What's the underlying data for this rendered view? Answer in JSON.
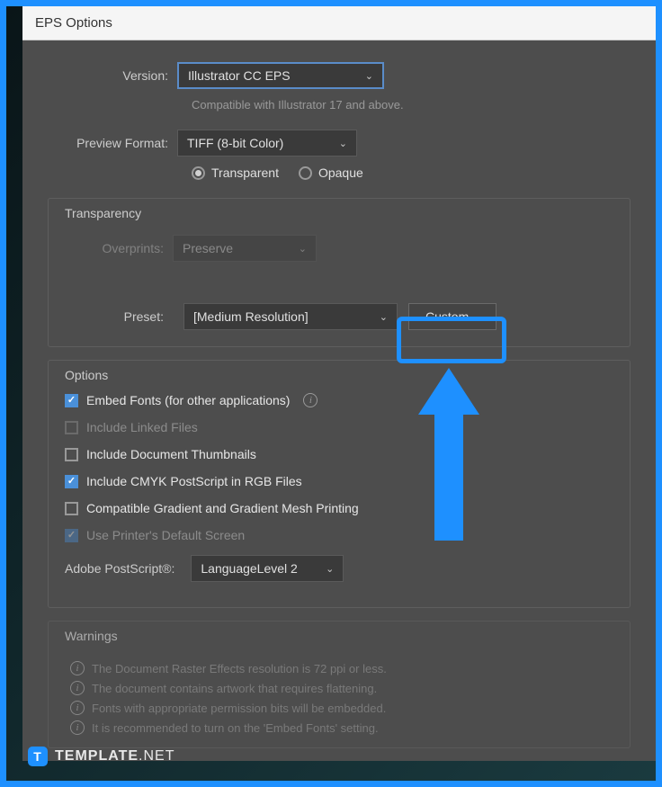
{
  "dialog": {
    "title": "EPS Options"
  },
  "version": {
    "label": "Version:",
    "value": "Illustrator CC EPS",
    "helper": "Compatible with Illustrator 17 and above."
  },
  "preview": {
    "label": "Preview Format:",
    "value": "TIFF (8-bit Color)",
    "radio_transparent": "Transparent",
    "radio_opaque": "Opaque"
  },
  "transparency": {
    "title": "Transparency",
    "overprints_label": "Overprints:",
    "overprints_value": "Preserve",
    "preset_label": "Preset:",
    "preset_value": "[Medium Resolution]",
    "custom_button": "Custom..."
  },
  "options": {
    "title": "Options",
    "embed_fonts": "Embed Fonts (for other applications)",
    "include_linked": "Include Linked Files",
    "include_thumbs": "Include Document Thumbnails",
    "include_cmyk": "Include CMYK PostScript in RGB Files",
    "compatible_gradient": "Compatible Gradient and Gradient Mesh Printing",
    "use_printer": "Use Printer's Default Screen",
    "postscript_label": "Adobe PostScript®:",
    "postscript_value": "LanguageLevel 2"
  },
  "warnings": {
    "title": "Warnings",
    "items": [
      "The Document Raster Effects resolution is 72 ppi or less.",
      "The document contains artwork that requires flattening.",
      "Fonts with appropriate permission bits will be embedded.",
      "It is recommended to turn on the 'Embed Fonts' setting."
    ]
  },
  "watermark": {
    "t": "T",
    "brand1": "TEMPLATE",
    "brand2": ".NET"
  }
}
